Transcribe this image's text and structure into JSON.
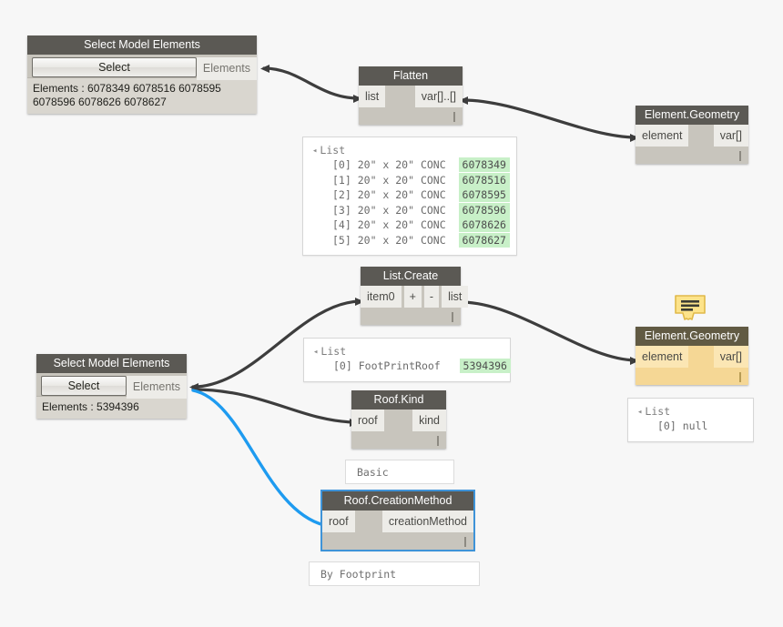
{
  "canvas": {
    "background": "#f7f7f7",
    "wire_color": "#3d3d3d",
    "selected_wire_color": "#1e9bf0",
    "node_header_color": "#5b5954",
    "node_body_color": "#c8c5bd",
    "warning_body_color": "#f5d795",
    "value_highlight_color": "#c8f0c8"
  },
  "nodes": {
    "select_model_elements_1": {
      "title": "Select Model Elements",
      "button_label": "Select",
      "port_label": "Elements",
      "info_text": "Elements : 6078349 6078516 6078595 6078596 6078626 6078627"
    },
    "flatten": {
      "title": "Flatten",
      "input_label": "list",
      "output_label": "var[]..[]"
    },
    "element_geometry_1": {
      "title": "Element.Geometry",
      "input_label": "element",
      "output_label": "var[]"
    },
    "list_create": {
      "title": "List.Create",
      "input_label": "item0",
      "add_label": "+",
      "remove_label": "-",
      "output_label": "list"
    },
    "select_model_elements_2": {
      "title": "Select Model Elements",
      "button_label": "Select",
      "port_label": "Elements",
      "info_text": "Elements : 5394396"
    },
    "roof_kind": {
      "title": "Roof.Kind",
      "input_label": "roof",
      "output_label": "kind"
    },
    "roof_creation_method": {
      "title": "Roof.CreationMethod",
      "input_label": "roof",
      "output_label": "creationMethod",
      "selected": true
    },
    "element_geometry_2": {
      "title": "Element.Geometry",
      "input_label": "element",
      "output_label": "var[]",
      "has_warning": true
    }
  },
  "previews": {
    "flatten_preview": {
      "header": "List",
      "rows": [
        {
          "index": "[0]",
          "text": "20\" x 20\" CONC",
          "value": "6078349"
        },
        {
          "index": "[1]",
          "text": "20\" x 20\" CONC",
          "value": "6078516"
        },
        {
          "index": "[2]",
          "text": "20\" x 20\" CONC",
          "value": "6078595"
        },
        {
          "index": "[3]",
          "text": "20\" x 20\" CONC",
          "value": "6078596"
        },
        {
          "index": "[4]",
          "text": "20\" x 20\" CONC",
          "value": "6078626"
        },
        {
          "index": "[5]",
          "text": "20\" x 20\" CONC",
          "value": "6078627"
        }
      ]
    },
    "list_create_preview": {
      "header": "List",
      "rows": [
        {
          "index": "[0]",
          "text": "FootPrintRoof",
          "value": "5394396"
        }
      ]
    },
    "element_geometry_2_preview": {
      "header": "List",
      "rows": [
        {
          "index": "[0]",
          "text": "null",
          "value": ""
        }
      ]
    },
    "roof_kind_preview": {
      "text": "Basic"
    },
    "roof_creation_method_preview": {
      "text": "By Footprint"
    }
  }
}
